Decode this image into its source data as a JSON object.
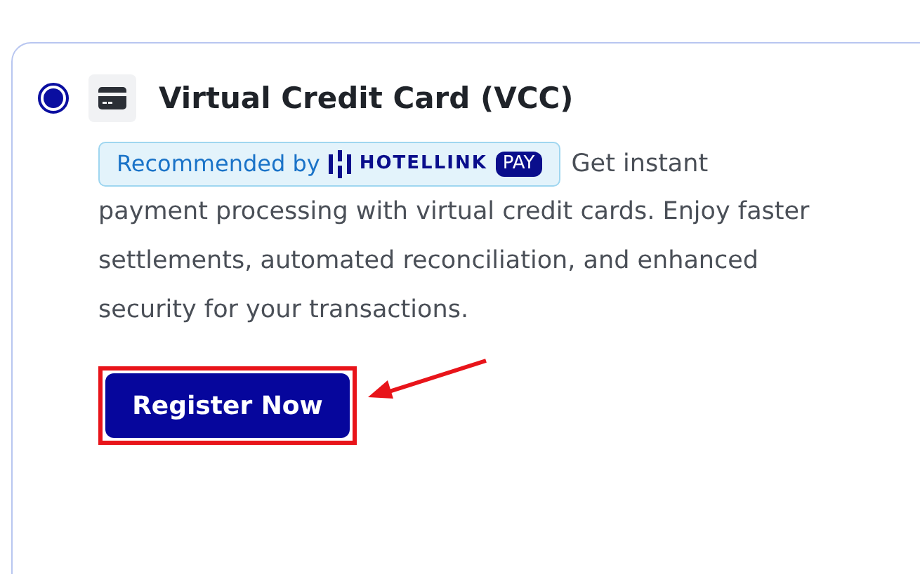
{
  "option": {
    "selected": true,
    "title": "Virtual Credit Card (VCC)",
    "badge": {
      "label": "Recommended by",
      "brand": "HOTELLINK",
      "brand_tag": "PAY"
    },
    "description_lead": "Get instant",
    "description": "payment processing with virtual credit cards. Enjoy faster settlements, automated reconciliation, and enhanced security for your transactions.",
    "button": "Register Now"
  }
}
